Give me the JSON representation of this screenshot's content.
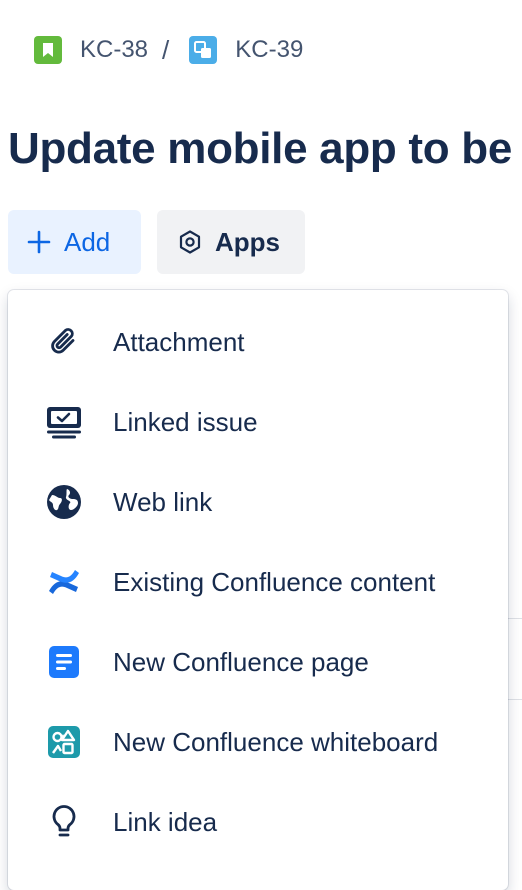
{
  "breadcrumb": {
    "parent": {
      "key": "KC-38",
      "icon": "story-icon",
      "color": "#63ba3c"
    },
    "separator": "/",
    "current": {
      "key": "KC-39",
      "icon": "subtask-icon",
      "color": "#4bade8"
    }
  },
  "issue": {
    "title": "Update mobile app to be"
  },
  "actions": {
    "add_label": "Add",
    "apps_label": "Apps"
  },
  "add_menu": {
    "items": [
      {
        "label": "Attachment",
        "icon": "paperclip-icon"
      },
      {
        "label": "Linked issue",
        "icon": "linked-issue-icon"
      },
      {
        "label": "Web link",
        "icon": "globe-icon"
      },
      {
        "label": "Existing Confluence content",
        "icon": "confluence-icon"
      },
      {
        "label": "New Confluence page",
        "icon": "page-icon"
      },
      {
        "label": "New Confluence whiteboard",
        "icon": "whiteboard-icon"
      },
      {
        "label": "Link idea",
        "icon": "lightbulb-icon"
      }
    ]
  },
  "colors": {
    "accent": "#0c66e4",
    "text": "#172b4d",
    "subtle": "#44546f"
  }
}
